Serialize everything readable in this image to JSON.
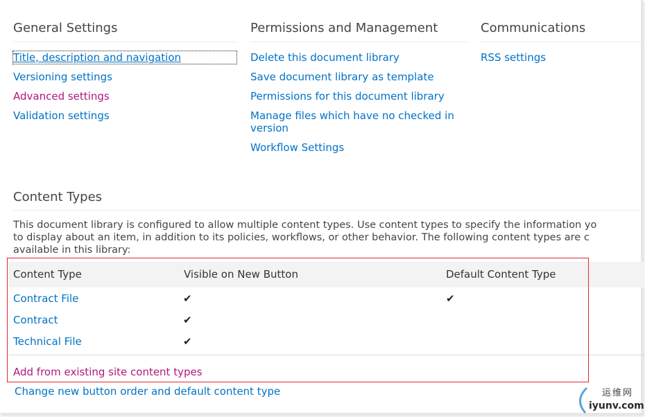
{
  "sections": {
    "general": {
      "title": "General Settings",
      "links": [
        "Title, description and navigation",
        "Versioning settings",
        "Advanced settings",
        "Validation settings"
      ]
    },
    "permissions": {
      "title": "Permissions and Management",
      "links": [
        "Delete this document library",
        "Save document library as template",
        "Permissions for this document library",
        "Manage files which have no checked in version",
        "Workflow Settings"
      ]
    },
    "communications": {
      "title": "Communications",
      "links": [
        "RSS settings"
      ]
    }
  },
  "content_types": {
    "title": "Content Types",
    "description_line1": "This document library is configured to allow multiple content types. Use content types to specify the information yo",
    "description_line2": "to display about an item, in addition to its policies, workflows, or other behavior. The following content types are c",
    "description_line3": "available in this library:",
    "columns": [
      "Content Type",
      "Visible on New Button",
      "Default Content Type"
    ],
    "rows": [
      {
        "name": "Contract File",
        "visible": "✔",
        "default": "✔"
      },
      {
        "name": "Contract",
        "visible": "✔",
        "default": ""
      },
      {
        "name": "Technical File",
        "visible": "✔",
        "default": ""
      }
    ],
    "add_link": "Add from existing site content types",
    "change_link": "Change new button order and default content type"
  },
  "watermark": {
    "cn": "运维网",
    "en": "iyunv.com"
  },
  "colors": {
    "link": "#0072c6",
    "visited_link": "#b0177e",
    "highlight_box": "#e0282f"
  }
}
